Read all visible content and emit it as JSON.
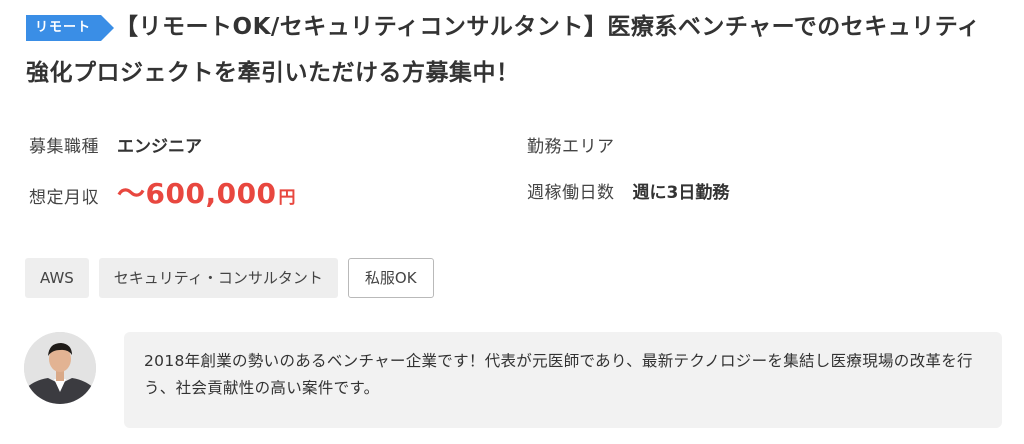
{
  "job": {
    "badge": "リモート",
    "title": "【リモートOK/セキュリティコンサルタント】医療系ベンチャーでのセキュリティ強化プロジェクトを牽引いただける方募集中！"
  },
  "info": {
    "position_label": "募集職種",
    "position_value": "エンジニア",
    "area_label": "勤務エリア",
    "area_value": "",
    "salary_label": "想定月収",
    "salary_value": "〜600,000",
    "salary_unit": "円",
    "workdays_label": "週稼働日数",
    "workdays_value": "週に3日勤務"
  },
  "tags": [
    {
      "label": "AWS"
    },
    {
      "label": "セキュリティ・コンサルタント"
    },
    {
      "label": "私服OK"
    }
  ],
  "message": {
    "text": "2018年創業の勢いのあるベンチャー企業です！代表が元医師であり、最新テクノロジーを集結し医療現場の改革を行う、社会貢献性の高い案件です。"
  },
  "colors": {
    "badge": "#3a8ee6",
    "salary": "#e8473f",
    "tag_bg": "#eeeeee",
    "bubble_bg": "#f2f2f2"
  },
  "icons": {
    "avatar": "person-avatar"
  }
}
